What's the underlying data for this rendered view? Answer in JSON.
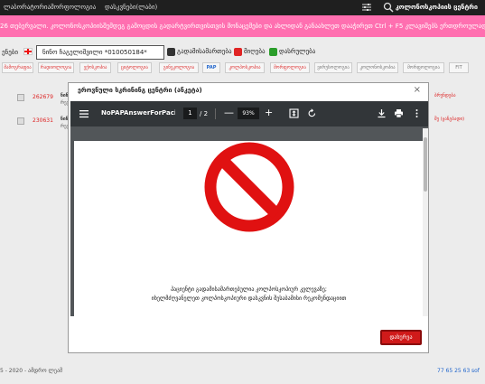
{
  "topnav": {
    "links": [
      "ლაბორატორია",
      "მორფოლოგია",
      "დასკვნები(ლაბი)"
    ],
    "brand": "კოლონოსკოპიის ცენტრი",
    "icons": [
      "settings-sliders-icon",
      "search-icon"
    ]
  },
  "announcement": "26 თებერვალი. კოლონოსკოპიისშემდეგ გამოცდის გადარტვირთვისთვის მონაცემები და ახლიდან განაახლეთ დააჭირეთ Ctrl + F5 კლავიშებს ერთდროულად",
  "filter": {
    "lang_label": "ენები",
    "search_value": "ნინო ჩაგელიშვილი *010050184*",
    "legend": [
      {
        "label": "გადამისამართება",
        "color": "#333333"
      },
      {
        "label": "მიღება",
        "color": "#e02424"
      },
      {
        "label": "დასრულება",
        "color": "#2a9d2a"
      }
    ]
  },
  "tabs": [
    {
      "label": "მამოგრაფია",
      "style": "red"
    },
    {
      "label": "რადიოლოგია",
      "style": "red"
    },
    {
      "label": "ექოსკოპია",
      "style": "red"
    },
    {
      "label": "ციტოლოგია",
      "style": "red"
    },
    {
      "label": "გინეკოლოგია",
      "style": "red"
    },
    {
      "label": "PAP",
      "style": "blue"
    },
    {
      "label": "კოლპოსკოპია",
      "style": "red"
    },
    {
      "label": "მორფოლოგია",
      "style": "red"
    },
    {
      "label": "ვირუსოლოგია",
      "style": "grey"
    },
    {
      "label": "კოლონოსკოპია",
      "style": "grey"
    },
    {
      "label": "მორფოლოგია",
      "style": "grey"
    },
    {
      "label": "FIT",
      "style": "grey"
    }
  ],
  "rows": [
    {
      "id": "262679",
      "name": "ნინ",
      "sub": "რეგ",
      "right": "ბრუნდება"
    },
    {
      "id": "230631",
      "name": "ნინ",
      "sub": "რეგ",
      "right": "შე (ჟანგბადი)"
    }
  ],
  "footer": {
    "left": "5 - 2020 - ამდრო ლეამ",
    "phone": "77 65 25 63",
    "mail": "sof"
  },
  "modal": {
    "title": "ეროვნული სკრინინგ ცენტრი (ანკეტა)",
    "close_glyph": "×",
    "pdf": {
      "filename": "NoPAPAnswerForPacie...",
      "page_current": "1",
      "page_total": "/ 2",
      "zoom": "93%",
      "zoom_minus": "—",
      "zoom_plus": "+",
      "message_line1": "პაციენტი გადამისამართებულია კოლპოსკოპიურ კვლევაზე;",
      "message_line2": "იხელმძღვანელეთ კოლპოსკოპიური დასკვნის შესაბამისი რეკომენდაციით",
      "icons": [
        "menu-icon",
        "fit-page-icon",
        "rotate-icon",
        "download-icon",
        "print-icon",
        "more-vert-icon"
      ],
      "symbol_color": "#e01111"
    },
    "close_button": "დახურვა"
  }
}
